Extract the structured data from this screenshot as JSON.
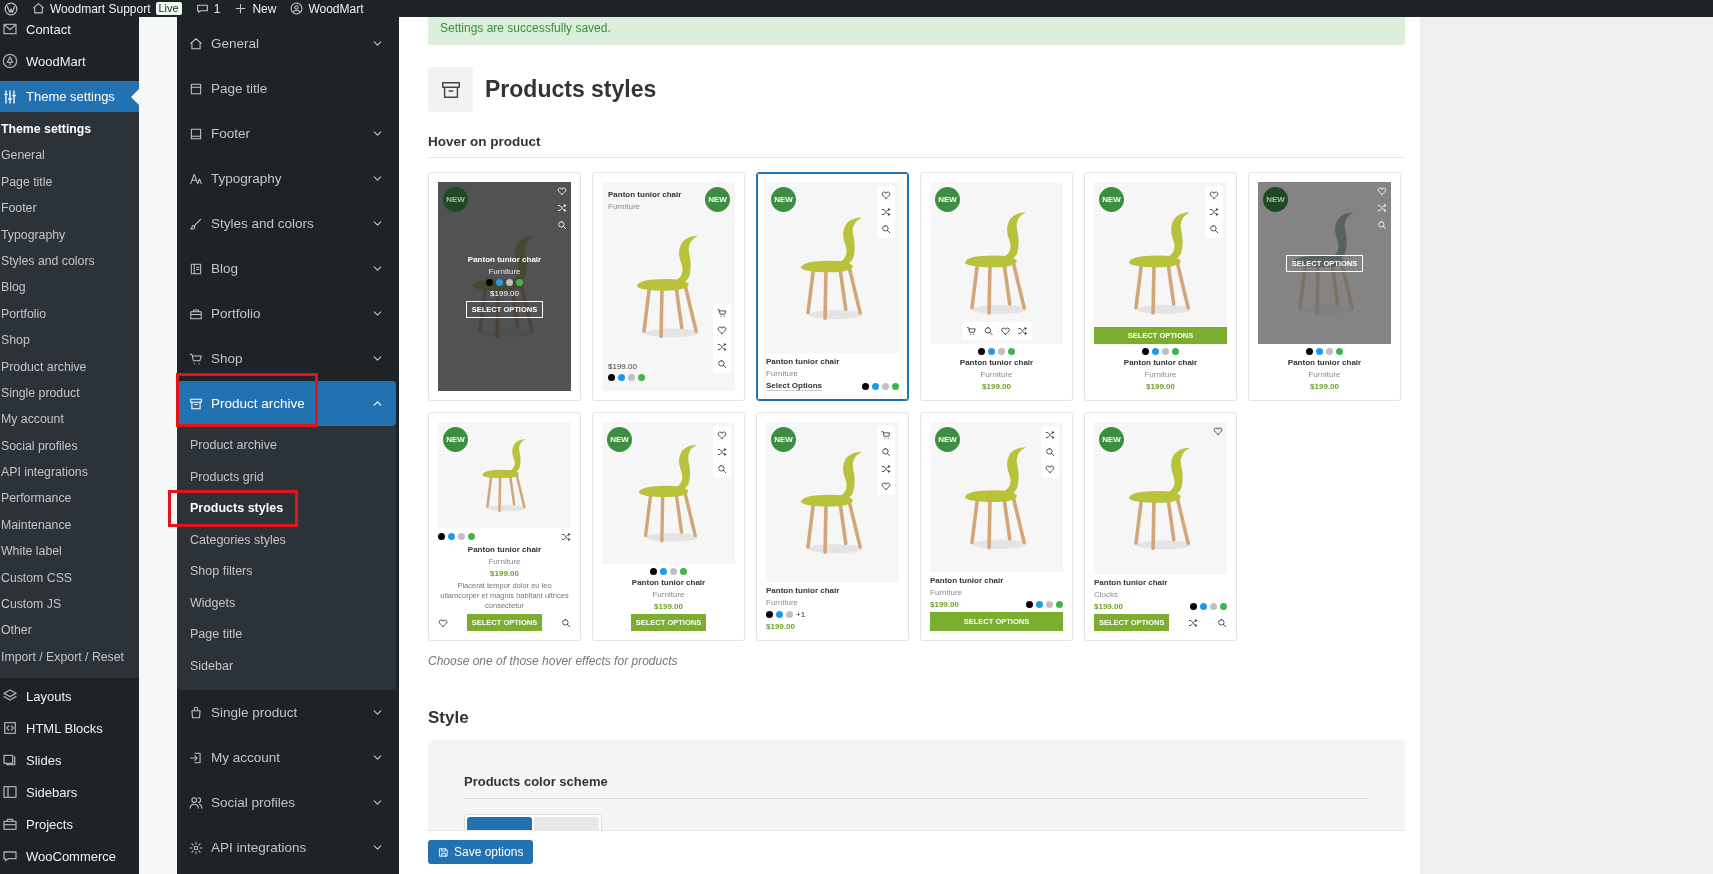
{
  "admin_bar": {
    "site": "Woodmart Support",
    "live": "Live",
    "comments": "1",
    "new": "New",
    "theme": "WoodMart"
  },
  "wp_menu": {
    "top": [
      {
        "label": "Contact",
        "selected": false
      },
      {
        "label": "WoodMart",
        "selected": false
      },
      {
        "label": "Theme settings",
        "selected": true
      }
    ],
    "submenu": [
      {
        "label": "Theme settings",
        "selected": true
      },
      {
        "label": "General",
        "selected": false
      },
      {
        "label": "Page title",
        "selected": false
      },
      {
        "label": "Footer",
        "selected": false
      },
      {
        "label": "Typography",
        "selected": false
      },
      {
        "label": "Styles and colors",
        "selected": false
      },
      {
        "label": "Blog",
        "selected": false
      },
      {
        "label": "Portfolio",
        "selected": false
      },
      {
        "label": "Shop",
        "selected": false
      },
      {
        "label": "Product archive",
        "selected": false
      },
      {
        "label": "Single product",
        "selected": false
      },
      {
        "label": "My account",
        "selected": false
      },
      {
        "label": "Social profiles",
        "selected": false
      },
      {
        "label": "API integrations",
        "selected": false
      },
      {
        "label": "Performance",
        "selected": false
      },
      {
        "label": "Maintenance",
        "selected": false
      },
      {
        "label": "White label",
        "selected": false
      },
      {
        "label": "Custom CSS",
        "selected": false
      },
      {
        "label": "Custom JS",
        "selected": false
      },
      {
        "label": "Other",
        "selected": false
      },
      {
        "label": "Import / Export / Reset",
        "selected": false
      }
    ],
    "bottom": [
      {
        "label": "Layouts",
        "selected": false
      },
      {
        "label": "HTML Blocks",
        "selected": false
      },
      {
        "label": "Slides",
        "selected": false
      },
      {
        "label": "Sidebars",
        "selected": false
      },
      {
        "label": "Projects",
        "selected": false
      },
      {
        "label": "WooCommerce",
        "selected": false
      }
    ]
  },
  "settings_nav": [
    {
      "kind": "group",
      "label": "General",
      "expanded": false,
      "selected": false,
      "highlighted": false
    },
    {
      "kind": "link",
      "label": "Page title",
      "selected": false,
      "highlighted": false
    },
    {
      "kind": "group",
      "label": "Footer",
      "expanded": false,
      "selected": false,
      "highlighted": false
    },
    {
      "kind": "group",
      "label": "Typography",
      "expanded": false,
      "selected": false,
      "highlighted": false
    },
    {
      "kind": "group",
      "label": "Styles and colors",
      "expanded": false,
      "selected": false,
      "highlighted": false
    },
    {
      "kind": "group",
      "label": "Blog",
      "expanded": false,
      "selected": false,
      "highlighted": false
    },
    {
      "kind": "group",
      "label": "Portfolio",
      "expanded": false,
      "selected": false,
      "highlighted": false
    },
    {
      "kind": "group",
      "label": "Shop",
      "expanded": false,
      "selected": false,
      "highlighted": false
    },
    {
      "kind": "group",
      "label": "Product archive",
      "expanded": true,
      "selected": true,
      "highlighted": true,
      "children": [
        {
          "label": "Product archive",
          "selected": false,
          "highlighted": false
        },
        {
          "label": "Products grid",
          "selected": false,
          "highlighted": false
        },
        {
          "label": "Products styles",
          "selected": true,
          "highlighted": true
        },
        {
          "label": "Categories styles",
          "selected": false,
          "highlighted": false
        },
        {
          "label": "Shop filters",
          "selected": false,
          "highlighted": false
        },
        {
          "label": "Widgets",
          "selected": false,
          "highlighted": false
        },
        {
          "label": "Page title",
          "selected": false,
          "highlighted": false
        },
        {
          "label": "Sidebar",
          "selected": false,
          "highlighted": false
        }
      ]
    },
    {
      "kind": "group",
      "label": "Single product",
      "expanded": false,
      "selected": false,
      "highlighted": false
    },
    {
      "kind": "group",
      "label": "My account",
      "expanded": false,
      "selected": false,
      "highlighted": false
    },
    {
      "kind": "group",
      "label": "Social profiles",
      "expanded": false,
      "selected": false,
      "highlighted": false
    },
    {
      "kind": "group",
      "label": "API integrations",
      "expanded": false,
      "selected": false,
      "highlighted": false
    }
  ],
  "notice": "Settings are successfully saved.",
  "page_title": "Products styles",
  "hover_section": {
    "label": "Hover on product",
    "cards": [
      {
        "kind": "info-overlay",
        "selected": false,
        "badge": "NEW",
        "title": "Panton tunior chair",
        "category": "Furniture",
        "price": "$199.00",
        "button": "SELECT OPTIONS",
        "swatches": [
          {
            "color": "#000000"
          },
          {
            "color": "#1e9be6"
          },
          {
            "color": "#c0c0c0"
          },
          {
            "color": "#3fb54a"
          }
        ]
      },
      {
        "kind": "alt-info",
        "selected": false,
        "badge": "NEW",
        "title": "Panton tunior chair",
        "category": "Furniture",
        "price": "$199.00",
        "swatches": [
          {
            "color": "#000000"
          },
          {
            "color": "#1e9be6"
          },
          {
            "color": "#c0c0c0"
          },
          {
            "color": "#3fb54a"
          }
        ]
      },
      {
        "kind": "icons-link",
        "selected": true,
        "badge": "NEW",
        "title": "Panton tunior chair",
        "category": "Furniture",
        "button": "Select Options",
        "swatches": [
          {
            "color": "#000000"
          },
          {
            "color": "#1e9be6"
          },
          {
            "color": "#c0c0c0"
          },
          {
            "color": "#3fb54a"
          }
        ]
      },
      {
        "kind": "bottom-icons",
        "selected": false,
        "badge": "NEW",
        "title": "Panton tunior chair",
        "category": "Furniture",
        "price": "$199.00",
        "swatches": [
          {
            "color": "#000000"
          },
          {
            "color": "#1e9be6"
          },
          {
            "color": "#c0c0c0"
          },
          {
            "color": "#3fb54a"
          }
        ]
      },
      {
        "kind": "button-bar",
        "selected": false,
        "badge": "NEW",
        "title": "Panton tunior chair",
        "category": "Furniture",
        "price": "$199.00",
        "button": "SELECT OPTIONS",
        "swatches": [
          {
            "color": "#000000"
          },
          {
            "color": "#1e9be6"
          },
          {
            "color": "#c0c0c0"
          },
          {
            "color": "#3fb54a"
          }
        ]
      },
      {
        "kind": "button-on-image",
        "selected": false,
        "badge": "NEW",
        "title": "Panton tunior chair",
        "category": "Furniture",
        "price": "$199.00",
        "button": "SELECT OPTIONS",
        "swatches": [
          {
            "color": "#000000"
          },
          {
            "color": "#1e9be6"
          },
          {
            "color": "#c0c0c0"
          },
          {
            "color": "#3fb54a"
          }
        ]
      },
      {
        "kind": "full-info",
        "selected": false,
        "badge": "NEW",
        "title": "Panton tunior chair",
        "category": "Furniture",
        "price": "$199.00",
        "description": "Placerat tempor dolor eu leo ullamcorper et magnis habitant ultrices consectetur",
        "button": "SELECT OPTIONS",
        "swatches": [
          {
            "color": "#000000"
          },
          {
            "color": "#1e9be6"
          },
          {
            "color": "#c0c0c0"
          },
          {
            "color": "#3fb54a"
          }
        ]
      },
      {
        "kind": "standard-button",
        "selected": false,
        "badge": "NEW",
        "title": "Panton tunior chair",
        "category": "Furniture",
        "price": "$199.00",
        "button": "SELECT OPTIONS",
        "swatches": [
          {
            "color": "#000000"
          },
          {
            "color": "#1e9be6"
          },
          {
            "color": "#c0c0c0"
          },
          {
            "color": "#3fb54a"
          }
        ]
      },
      {
        "kind": "compact",
        "selected": false,
        "badge": "NEW",
        "title": "Panton tunior chair",
        "category": "Furniture",
        "price": "$199.00",
        "more": "+1",
        "swatches": [
          {
            "color": "#000000"
          },
          {
            "color": "#1e9be6"
          },
          {
            "color": "#c0c0c0"
          }
        ]
      },
      {
        "kind": "wide-button",
        "selected": false,
        "badge": "NEW",
        "title": "Panton tunior chair",
        "category": "Furniture",
        "price": "$199.00",
        "button": "SELECT OPTIONS",
        "swatches": [
          {
            "color": "#000000"
          },
          {
            "color": "#1e9be6"
          },
          {
            "color": "#c0c0c0"
          },
          {
            "color": "#3fb54a"
          }
        ]
      },
      {
        "kind": "button-row",
        "selected": false,
        "badge": "NEW",
        "title": "Panton tunior chair",
        "category": "Clocks",
        "price": "$199.00",
        "button": "SELECT OPTIONS",
        "swatches": [
          {
            "color": "#000000"
          },
          {
            "color": "#1e9be6"
          },
          {
            "color": "#c0c0c0"
          },
          {
            "color": "#3fb54a"
          }
        ]
      }
    ],
    "caption": "Choose one of those hover effects for products"
  },
  "style_section": {
    "heading": "Style",
    "field_label": "Products color scheme",
    "options": [
      {
        "selected": true
      },
      {
        "selected": false
      }
    ]
  },
  "save_button": "Save options"
}
